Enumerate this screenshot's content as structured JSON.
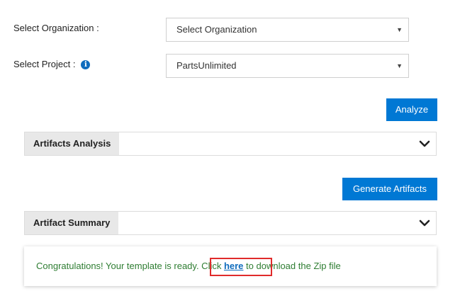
{
  "form": {
    "org_label": "Select Organization :",
    "org_value": "Select Organization",
    "project_label": "Select Project :",
    "project_value": "PartsUnlimited"
  },
  "buttons": {
    "analyze": "Analyze",
    "generate": "Generate Artifacts"
  },
  "panels": {
    "analysis_title": "Artifacts Analysis",
    "summary_title": "Artifact Summary"
  },
  "message": {
    "text_before": "Congratulations! Your template is ready. Click ",
    "link": "here",
    "text_after": " to download the Zip file"
  },
  "colors": {
    "accent": "#0078d4",
    "success_text": "#2e7d32",
    "highlight": "#e02b2b"
  },
  "icons": {
    "info": "info-icon",
    "dropdown": "caret-down-icon",
    "collapse": "chevron-down-icon"
  }
}
